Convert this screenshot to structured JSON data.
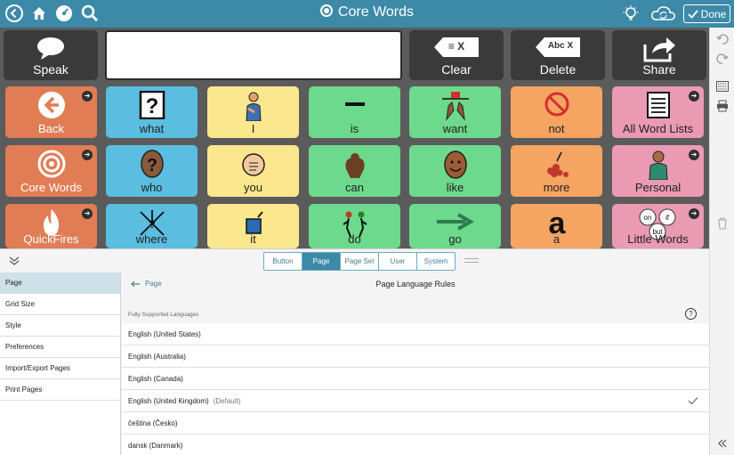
{
  "header": {
    "title": "Core Words",
    "done_label": "Done"
  },
  "controls": {
    "speak": "Speak",
    "message": "",
    "clear": "Clear",
    "clear_icon_text": "≡ X",
    "delete": "Delete",
    "delete_icon_text": "Abc X",
    "share": "Share"
  },
  "grid": [
    {
      "label": "Back",
      "color": "core",
      "icon": "back-arrow-icon"
    },
    {
      "label": "what",
      "color": "blue",
      "icon": "question-card-icon"
    },
    {
      "label": "I",
      "color": "yellow",
      "icon": "person-self-icon"
    },
    {
      "label": "is",
      "color": "green",
      "icon": "dash-icon"
    },
    {
      "label": "want",
      "color": "green",
      "icon": "want-hands-icon"
    },
    {
      "label": "not",
      "color": "orange",
      "icon": "no-sign-icon"
    },
    {
      "label": "All Word Lists",
      "color": "pink",
      "icon": "list-icon"
    },
    {
      "label": "Core Words",
      "color": "core",
      "icon": "target-icon"
    },
    {
      "label": "who",
      "color": "blue",
      "icon": "question-head-icon"
    },
    {
      "label": "you",
      "color": "yellow",
      "icon": "pointing-icon"
    },
    {
      "label": "can",
      "color": "green",
      "icon": "strong-arm-icon"
    },
    {
      "label": "like",
      "color": "green",
      "icon": "smiling-face-icon"
    },
    {
      "label": "more",
      "color": "orange",
      "icon": "more-pile-icon"
    },
    {
      "label": "Personal",
      "color": "pink",
      "icon": "personal-icon"
    },
    {
      "label": "QuickFires",
      "color": "core",
      "icon": "fire-icon"
    },
    {
      "label": "where",
      "color": "blue",
      "icon": "arrows-icon"
    },
    {
      "label": "it",
      "color": "yellow",
      "icon": "it-pointer-icon"
    },
    {
      "label": "do",
      "color": "green",
      "icon": "action-figures-icon"
    },
    {
      "label": "go",
      "color": "green",
      "icon": "right-arrow-icon"
    },
    {
      "label": "a",
      "color": "orange",
      "icon": "letter-a-icon"
    },
    {
      "label": "Little Words",
      "color": "pink",
      "icon": "little-words-icon"
    }
  ],
  "tile_symbols": {
    "what": "?",
    "letter_a": "a",
    "little_on": "on",
    "little_if": "if",
    "little_but": "but"
  },
  "tabs": [
    {
      "label": "Button",
      "active": false
    },
    {
      "label": "Page",
      "active": true
    },
    {
      "label": "Page Set",
      "active": false
    },
    {
      "label": "User",
      "active": false
    },
    {
      "label": "System",
      "active": false
    }
  ],
  "sidebar_nav": [
    {
      "label": "Page",
      "active": true
    },
    {
      "label": "Grid Size",
      "active": false
    },
    {
      "label": "Style",
      "active": false
    },
    {
      "label": "Preferences",
      "active": false
    },
    {
      "label": "Import/Export Pages",
      "active": false
    },
    {
      "label": "Print Pages",
      "active": false
    }
  ],
  "content": {
    "breadcrumb": "Page",
    "title": "Page Language Rules",
    "section_label": "Fully Supported Languages",
    "help_symbol": "?",
    "languages": [
      {
        "name": "English (United States)",
        "note": "",
        "selected": false
      },
      {
        "name": "English (Australia)",
        "note": "",
        "selected": false
      },
      {
        "name": "English (Canada)",
        "note": "",
        "selected": false
      },
      {
        "name": "English (United Kingdom)",
        "note": "(Default)",
        "selected": true
      },
      {
        "name": "čeština (Česko)",
        "note": "",
        "selected": false
      },
      {
        "name": "dansk (Danmark)",
        "note": "",
        "selected": false
      }
    ]
  },
  "colors": {
    "header": "#3d8aa8",
    "core": "#e07d55",
    "blue": "#5bbde0",
    "yellow": "#fbe78d",
    "green": "#6dd98c",
    "orange": "#f5a461",
    "pink": "#ea9ab3"
  }
}
